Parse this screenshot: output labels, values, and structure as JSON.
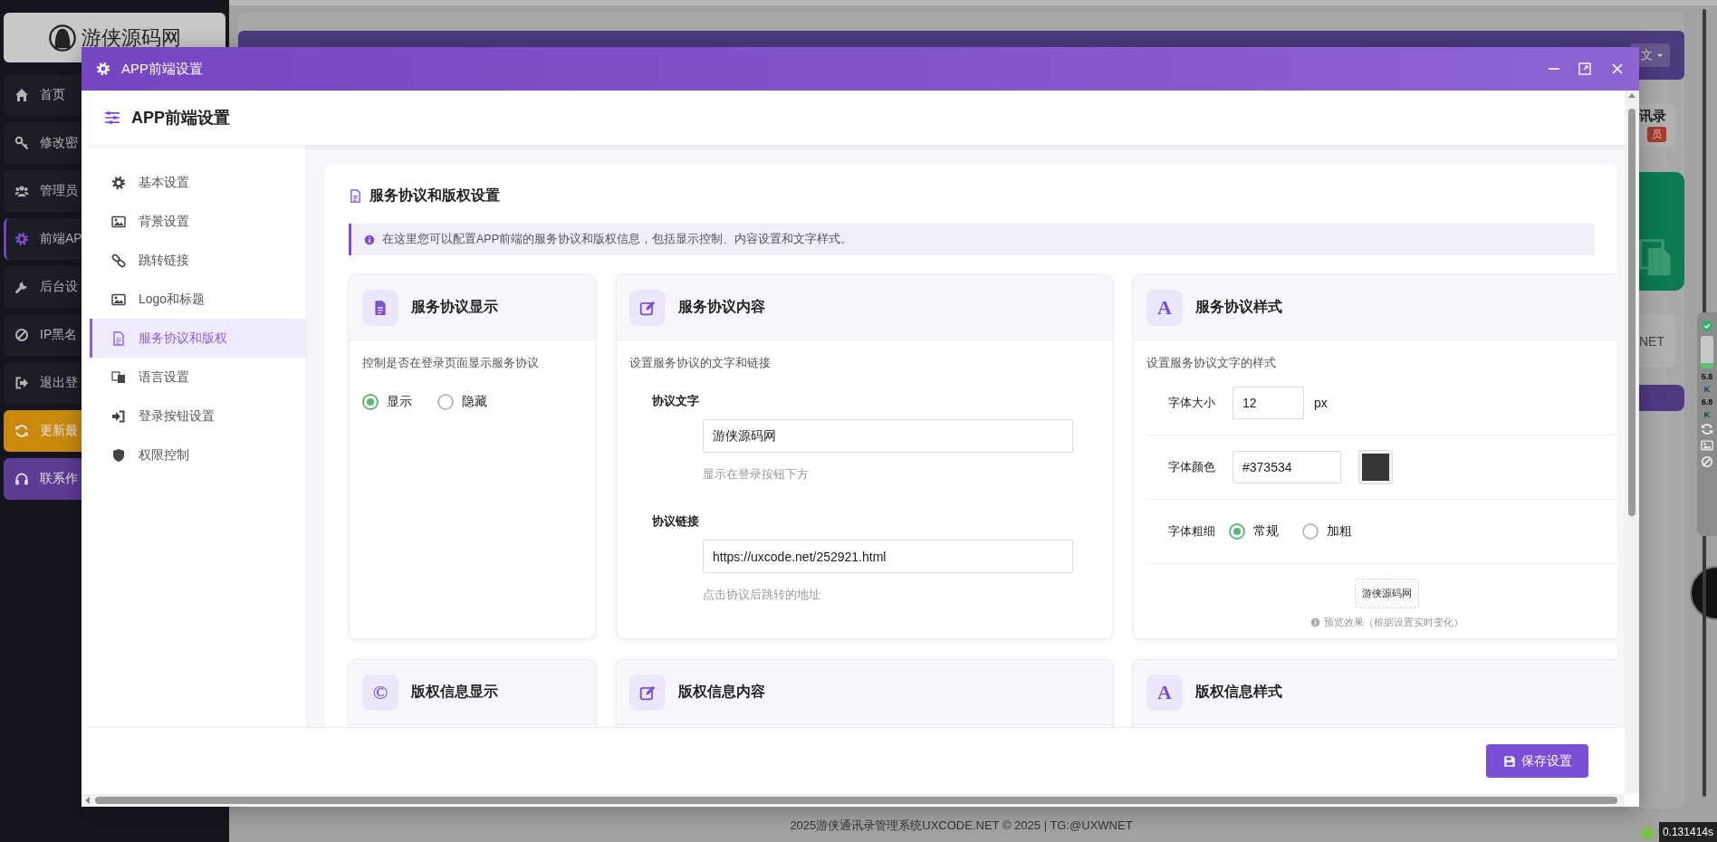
{
  "sidebar": {
    "logo": "游侠源码网",
    "items": [
      {
        "label": "首页",
        "selected": false
      },
      {
        "label": "修改密",
        "selected": false
      },
      {
        "label": "管理员",
        "selected": false
      },
      {
        "label": "前端AP",
        "selected": true
      },
      {
        "label": "后台设",
        "selected": false
      },
      {
        "label": "IP黑名",
        "selected": false
      },
      {
        "label": "退出登",
        "selected": false
      },
      {
        "label": "更新最",
        "selected": false,
        "color": "#c98a0c"
      },
      {
        "label": "联系作",
        "selected": false,
        "color": "#5e3b94"
      }
    ]
  },
  "main": {
    "language": "文",
    "stat_title": "讯录",
    "stat_badge": "员",
    "site_text": "NET",
    "widget_readings": [
      {
        "value": "5.8",
        "unit": "K"
      },
      {
        "value": "6.8",
        "unit": "K"
      }
    ]
  },
  "modal": {
    "title": "APP前端设置",
    "panel_title": "APP前端设置",
    "nav": [
      {
        "label": "基本设置",
        "selected": false
      },
      {
        "label": "背景设置",
        "selected": false
      },
      {
        "label": "跳转链接",
        "selected": false
      },
      {
        "label": "Logo和标题",
        "selected": false
      },
      {
        "label": "服务协议和版权",
        "selected": true
      },
      {
        "label": "语言设置",
        "selected": false
      },
      {
        "label": "登录按钮设置",
        "selected": false
      },
      {
        "label": "权限控制",
        "selected": false
      }
    ],
    "section": {
      "title": "服务协议和版权设置",
      "info": "在这里您可以配置APP前端的服务协议和版权信息，包括显示控制、内容设置和文字样式。"
    },
    "cards": [
      {
        "kind": "toggle",
        "title": "服务协议显示",
        "description": "控制是否在登录页面显示服务协议",
        "options": [
          {
            "label": "显示",
            "selected": true
          },
          {
            "label": "隐藏",
            "selected": false
          }
        ]
      },
      {
        "kind": "content",
        "title": "服务协议内容",
        "description": "设置服务协议的文字和链接",
        "fields": [
          {
            "label": "协议文字",
            "value": "游侠源码网",
            "hint": "显示在登录按钮下方"
          },
          {
            "label": "协议链接",
            "value": "https://uxcode.net/252921.html",
            "hint": "点击协议后跳转的地址"
          }
        ]
      },
      {
        "kind": "style",
        "title": "服务协议样式",
        "glyph": "A",
        "description": "设置服务协议文字的样式",
        "rows": [
          {
            "kind": "number",
            "label": "字体大小",
            "value": "12",
            "unit": "px"
          },
          {
            "kind": "color",
            "label": "字体颜色",
            "value": "#373534",
            "color": "#373534"
          },
          {
            "kind": "radio",
            "label": "字体粗细",
            "options": [
              {
                "label": "常规",
                "selected": true
              },
              {
                "label": "加粗",
                "selected": false
              }
            ]
          }
        ],
        "preview": {
          "text": "游侠源码网",
          "caption": "预览效果（根据设置实时变化）"
        }
      },
      {
        "kind": "toggle",
        "title": "版权信息显示",
        "glyph": "©"
      },
      {
        "kind": "content",
        "title": "版权信息内容"
      },
      {
        "kind": "style",
        "title": "版权信息样式",
        "glyph": "A"
      }
    ],
    "save_label": "保存设置"
  },
  "footer": {
    "copyright": "2025游侠通讯录管理系统UXCODE.NET © 2025 | TG:@UXWNET",
    "timer": "0.131414s"
  }
}
